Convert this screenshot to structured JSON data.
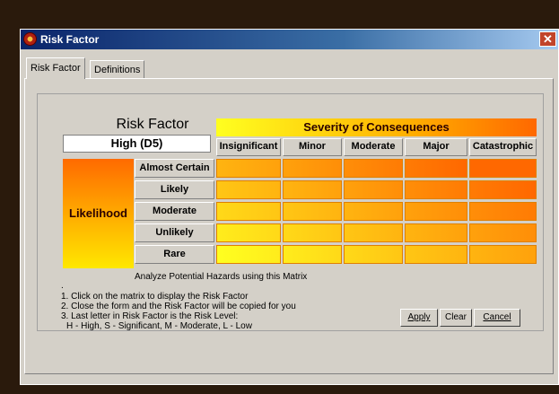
{
  "window": {
    "title": "Risk Factor",
    "close_glyph": "✕"
  },
  "tabs": [
    {
      "label": "Risk Factor",
      "active": true
    },
    {
      "label": "Definitions",
      "active": false
    }
  ],
  "matrix": {
    "title": "Risk Factor",
    "value": "High (D5)",
    "severity_label": "Severity of Consequences",
    "likelihood_label": "Likelihood",
    "columns": [
      "Insignificant",
      "Minor",
      "Moderate",
      "Major",
      "Catastrophic"
    ],
    "rows": [
      "Almost Certain",
      "Likely",
      "Moderate",
      "Unlikely",
      "Rare"
    ]
  },
  "analyze_text": "Analyze Potential Hazards using this Matrix",
  "instructions": {
    "dot": ".",
    "line1": "1. Click on the matrix to display the Risk Factor",
    "line2": "2. Close the form and the Risk Factor will be copied for you",
    "line3": "3. Last letter in Risk Factor is the Risk Level:",
    "line4": "H - High, S - Significant, M - Moderate, L - Low"
  },
  "buttons": {
    "apply": "Apply",
    "clear": "Clear",
    "cancel": "Cancel"
  },
  "icons": {
    "title": "biohazard-icon",
    "close": "close-icon"
  },
  "colors": {
    "title_bar": "#0a246a",
    "cell_high": "#ff6800",
    "cell_low": "#ffff20",
    "cell_border": "#e08000"
  }
}
